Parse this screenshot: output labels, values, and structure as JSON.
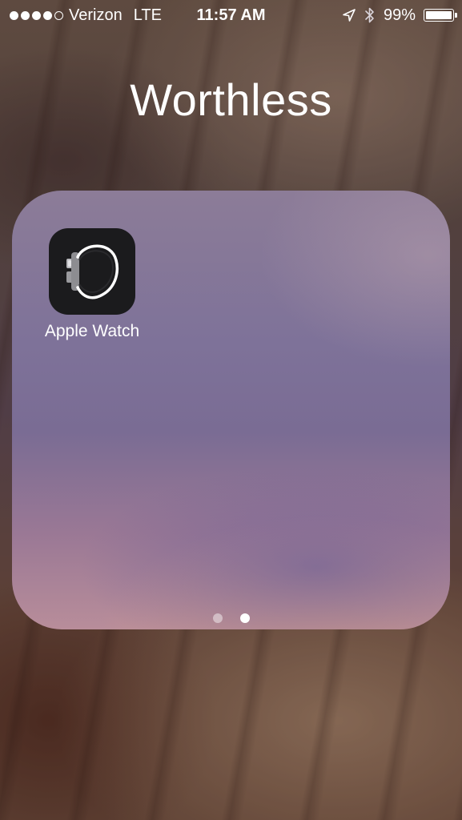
{
  "status_bar": {
    "signal_filled": 4,
    "signal_total": 5,
    "carrier": "Verizon",
    "network": "LTE",
    "time": "11:57 AM",
    "battery_text": "99%",
    "battery_level": 0.99,
    "icons": [
      "location-arrow-icon",
      "bluetooth-icon",
      "battery-icon"
    ]
  },
  "folder": {
    "title": "Worthless",
    "apps": [
      {
        "label": "Apple Watch",
        "icon": "apple-watch-icon",
        "icon_bg": "#1b1b1d"
      }
    ],
    "pages": 2,
    "current_page": 2
  }
}
